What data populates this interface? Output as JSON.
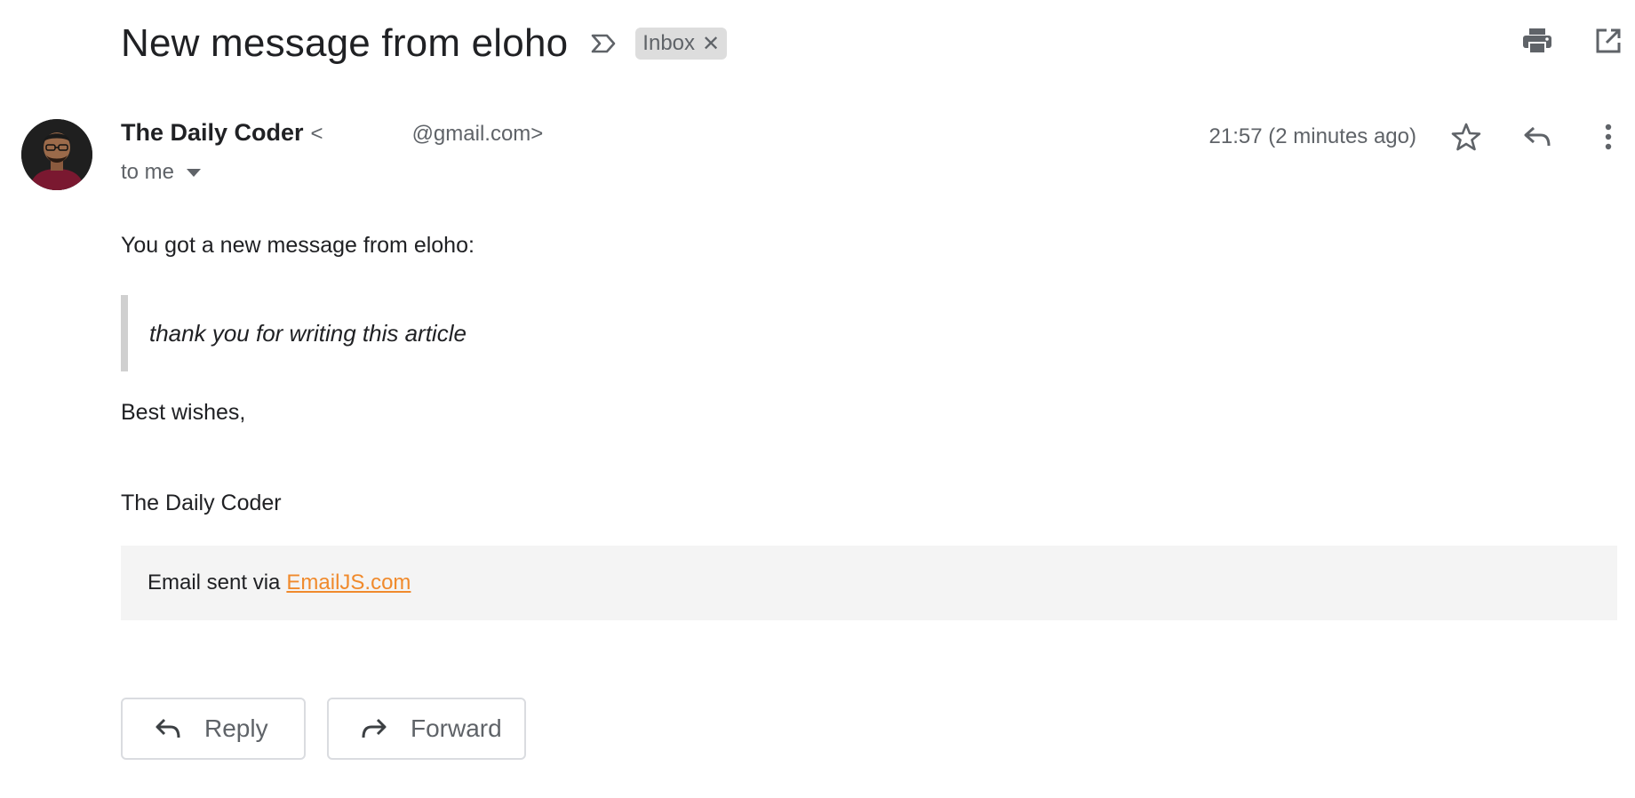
{
  "subject": {
    "title": "New message from eloho",
    "label": "Inbox"
  },
  "sender": {
    "name": "The Daily Coder",
    "email_prefix": "<",
    "email_suffix": "@gmail.com>",
    "recipient": "to me",
    "timestamp": "21:57 (2 minutes ago)"
  },
  "body": {
    "intro": "You got a new message from eloho:",
    "quote": "thank you for writing this article",
    "closing": "Best wishes,",
    "signature": "The Daily Coder",
    "footer_text": "Email sent via",
    "footer_link": "EmailJS.com"
  },
  "actions": {
    "reply": "Reply",
    "forward": "Forward"
  },
  "icons": {
    "importance": "importance-marker-icon",
    "print": "print-icon",
    "open_new_window": "open-in-new-window-icon",
    "star": "star-icon",
    "reply": "reply-icon",
    "more": "more-vert-icon",
    "forward": "forward-icon"
  },
  "colors": {
    "link": "#f08a2c",
    "chip_bg": "#dddddd",
    "footer_bg": "#f4f4f4",
    "quote_border": "#d0d0d0"
  }
}
